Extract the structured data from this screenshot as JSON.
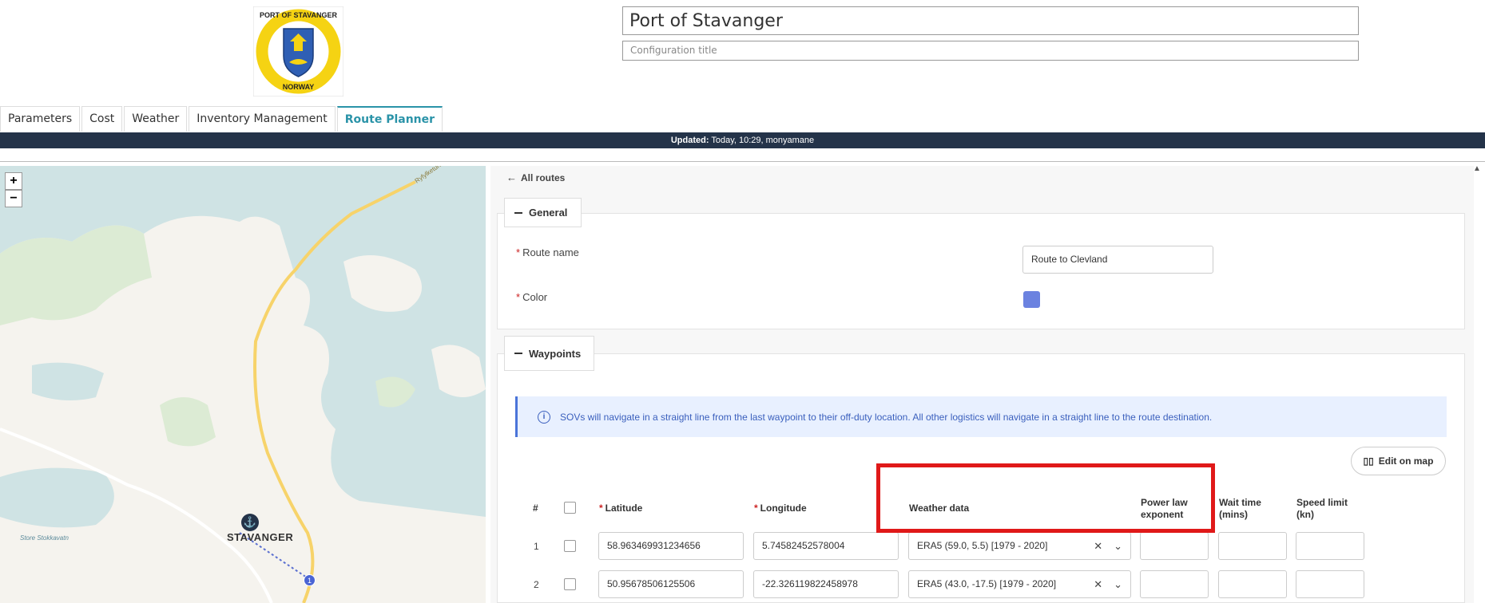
{
  "header": {
    "logo_text_top": "PORT OF STAVANGER",
    "logo_text_bottom": "NORWAY",
    "title_value": "Port of Stavanger",
    "config_placeholder": "Configuration title"
  },
  "tabs": [
    {
      "label": "Parameters"
    },
    {
      "label": "Cost"
    },
    {
      "label": "Weather"
    },
    {
      "label": "Inventory Management"
    },
    {
      "label": "Route Planner",
      "active": true
    }
  ],
  "updated_bar": {
    "label": "Updated:",
    "value": "Today, 10:29, monyamane"
  },
  "map": {
    "zoom_in": "+",
    "zoom_out": "−",
    "city_label": "STAVANGER",
    "place_label": "Store Stokkavatn",
    "waypoint_marker": "1",
    "road_label": "Ryfylketunnelen",
    "colors": {
      "water": "#cfe3e4",
      "land": "#f5f3ee",
      "park": "#dcebd4",
      "road": "#f7d36a"
    }
  },
  "panel": {
    "back_link": "All routes",
    "general": {
      "title": "General",
      "route_name_label": "Route name",
      "route_name_value": "Route to Clevland",
      "color_label": "Color",
      "color_value": "#6b82e0"
    },
    "waypoints": {
      "title": "Waypoints",
      "info_icon": "info-icon",
      "info_text": "SOVs will navigate in a straight line from the last waypoint to their off-duty location. All other logistics will navigate in a straight line to the route destination.",
      "edit_on_map": "Edit on map",
      "columns": {
        "num": "#",
        "latitude": "Latitude",
        "longitude": "Longitude",
        "weather": "Weather data",
        "power_1": "Power law",
        "power_2": "exponent",
        "wait_1": "Wait time",
        "wait_2": "(mins)",
        "speed_1": "Speed limit",
        "speed_2": "(kn)"
      },
      "rows": [
        {
          "num": "1",
          "latitude": "58.963469931234656",
          "longitude": "5.74582452578004",
          "weather": "ERA5 (59.0, 5.5) [1979 - 2020]"
        },
        {
          "num": "2",
          "latitude": "50.95678506125506",
          "longitude": "-22.326119822458978",
          "weather": "ERA5 (43.0, -17.5) [1979 - 2020]"
        }
      ]
    }
  }
}
